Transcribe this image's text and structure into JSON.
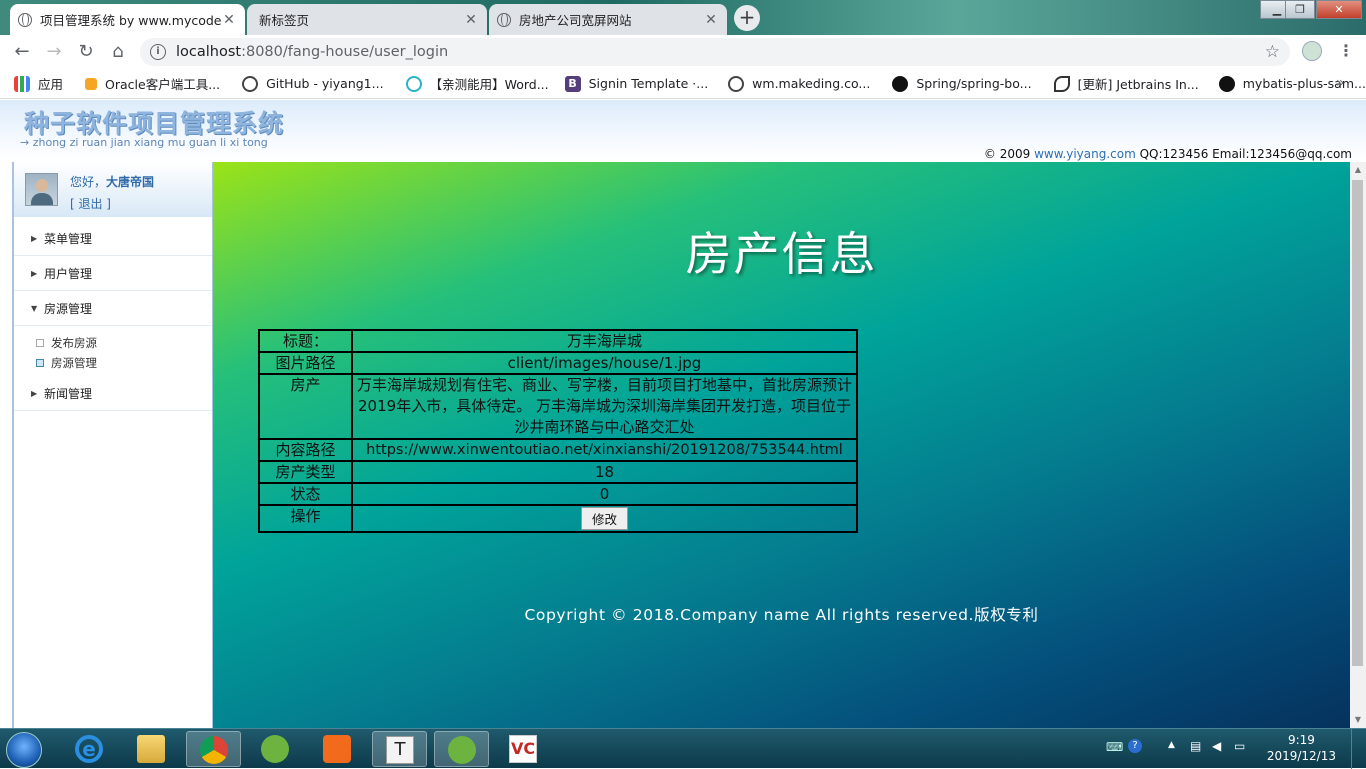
{
  "browser": {
    "tabs": [
      {
        "label": "项目管理系统 by www.mycodes",
        "active": true
      },
      {
        "label": "新标签页",
        "active": false
      },
      {
        "label": "房地产公司宽屏网站",
        "active": false
      }
    ],
    "new_tab": "+",
    "url_host": "localhost",
    "url_path": ":8080/fang-house/user_login",
    "bookmarks": [
      {
        "label": "应用",
        "icon": "apps-grid-icon"
      },
      {
        "label": "Oracle客户端工具...",
        "icon": "oracle-icon"
      },
      {
        "label": "GitHub - yiyang1...",
        "icon": "globe-icon"
      },
      {
        "label": "【亲测能用】Word...",
        "icon": "play-icon"
      },
      {
        "label": "Signin Template ·...",
        "icon": "bootstrap-icon"
      },
      {
        "label": "wm.makeding.co...",
        "icon": "globe-icon"
      },
      {
        "label": "Spring/spring-bo...",
        "icon": "github-icon"
      },
      {
        "label": "[更新] Jetbrains In...",
        "icon": "jetbrains-icon"
      },
      {
        "label": "mybatis-plus-sam...",
        "icon": "github-icon"
      }
    ]
  },
  "header": {
    "logo": "种子软件项目管理系统",
    "logo_sub": "→ zhong zi ruan jian xiang mu guan li xi tong",
    "copyright_prefix": "© 2009",
    "copyright_link": "www.yiyang.com",
    "copyright_suffix": "QQ:123456 Email:123456@qq.com"
  },
  "sidebar": {
    "greeting": "您好，",
    "username": "大唐帝国",
    "logout": "[ 退出 ]",
    "menus": [
      {
        "label": "菜单管理",
        "expanded": false
      },
      {
        "label": "用户管理",
        "expanded": false
      },
      {
        "label": "房源管理",
        "expanded": true
      },
      {
        "label": "新闻管理",
        "expanded": false
      }
    ],
    "submenu": [
      {
        "label": "发布房源",
        "selected": false
      },
      {
        "label": "房源管理",
        "selected": true
      }
    ]
  },
  "main": {
    "title": "房产信息",
    "rows": [
      {
        "key": "标题：",
        "value": "万丰海岸城"
      },
      {
        "key": "图片路径",
        "value": "client/images/house/1.jpg"
      },
      {
        "key": "房产",
        "value": "万丰海岸城规划有住宅、商业、写字楼，目前项目打地基中，首批房源预计2019年入市，具体待定。 万丰海岸城为深圳海岸集团开发打造，项目位于沙井南环路与中心路交汇处"
      },
      {
        "key": "内容路径",
        "value": "https://www.xinwentoutiao.net/xinxianshi/20191208/753544.html"
      },
      {
        "key": "房产类型",
        "value": "18"
      },
      {
        "key": "状态",
        "value": "0"
      },
      {
        "key": "操作",
        "value": ""
      }
    ],
    "edit_button": "修改",
    "footer": "Copyright © 2018.Company name All rights reserved.版权专利"
  },
  "taskbar": {
    "apps": [
      "internet-explorer-icon",
      "file-explorer-icon",
      "chrome-icon",
      "spring-tool-icon",
      "app-orange-icon",
      "typora-icon",
      "spring-boot-icon",
      "vc-icon"
    ],
    "time": "9:19",
    "date": "2019/12/13"
  }
}
